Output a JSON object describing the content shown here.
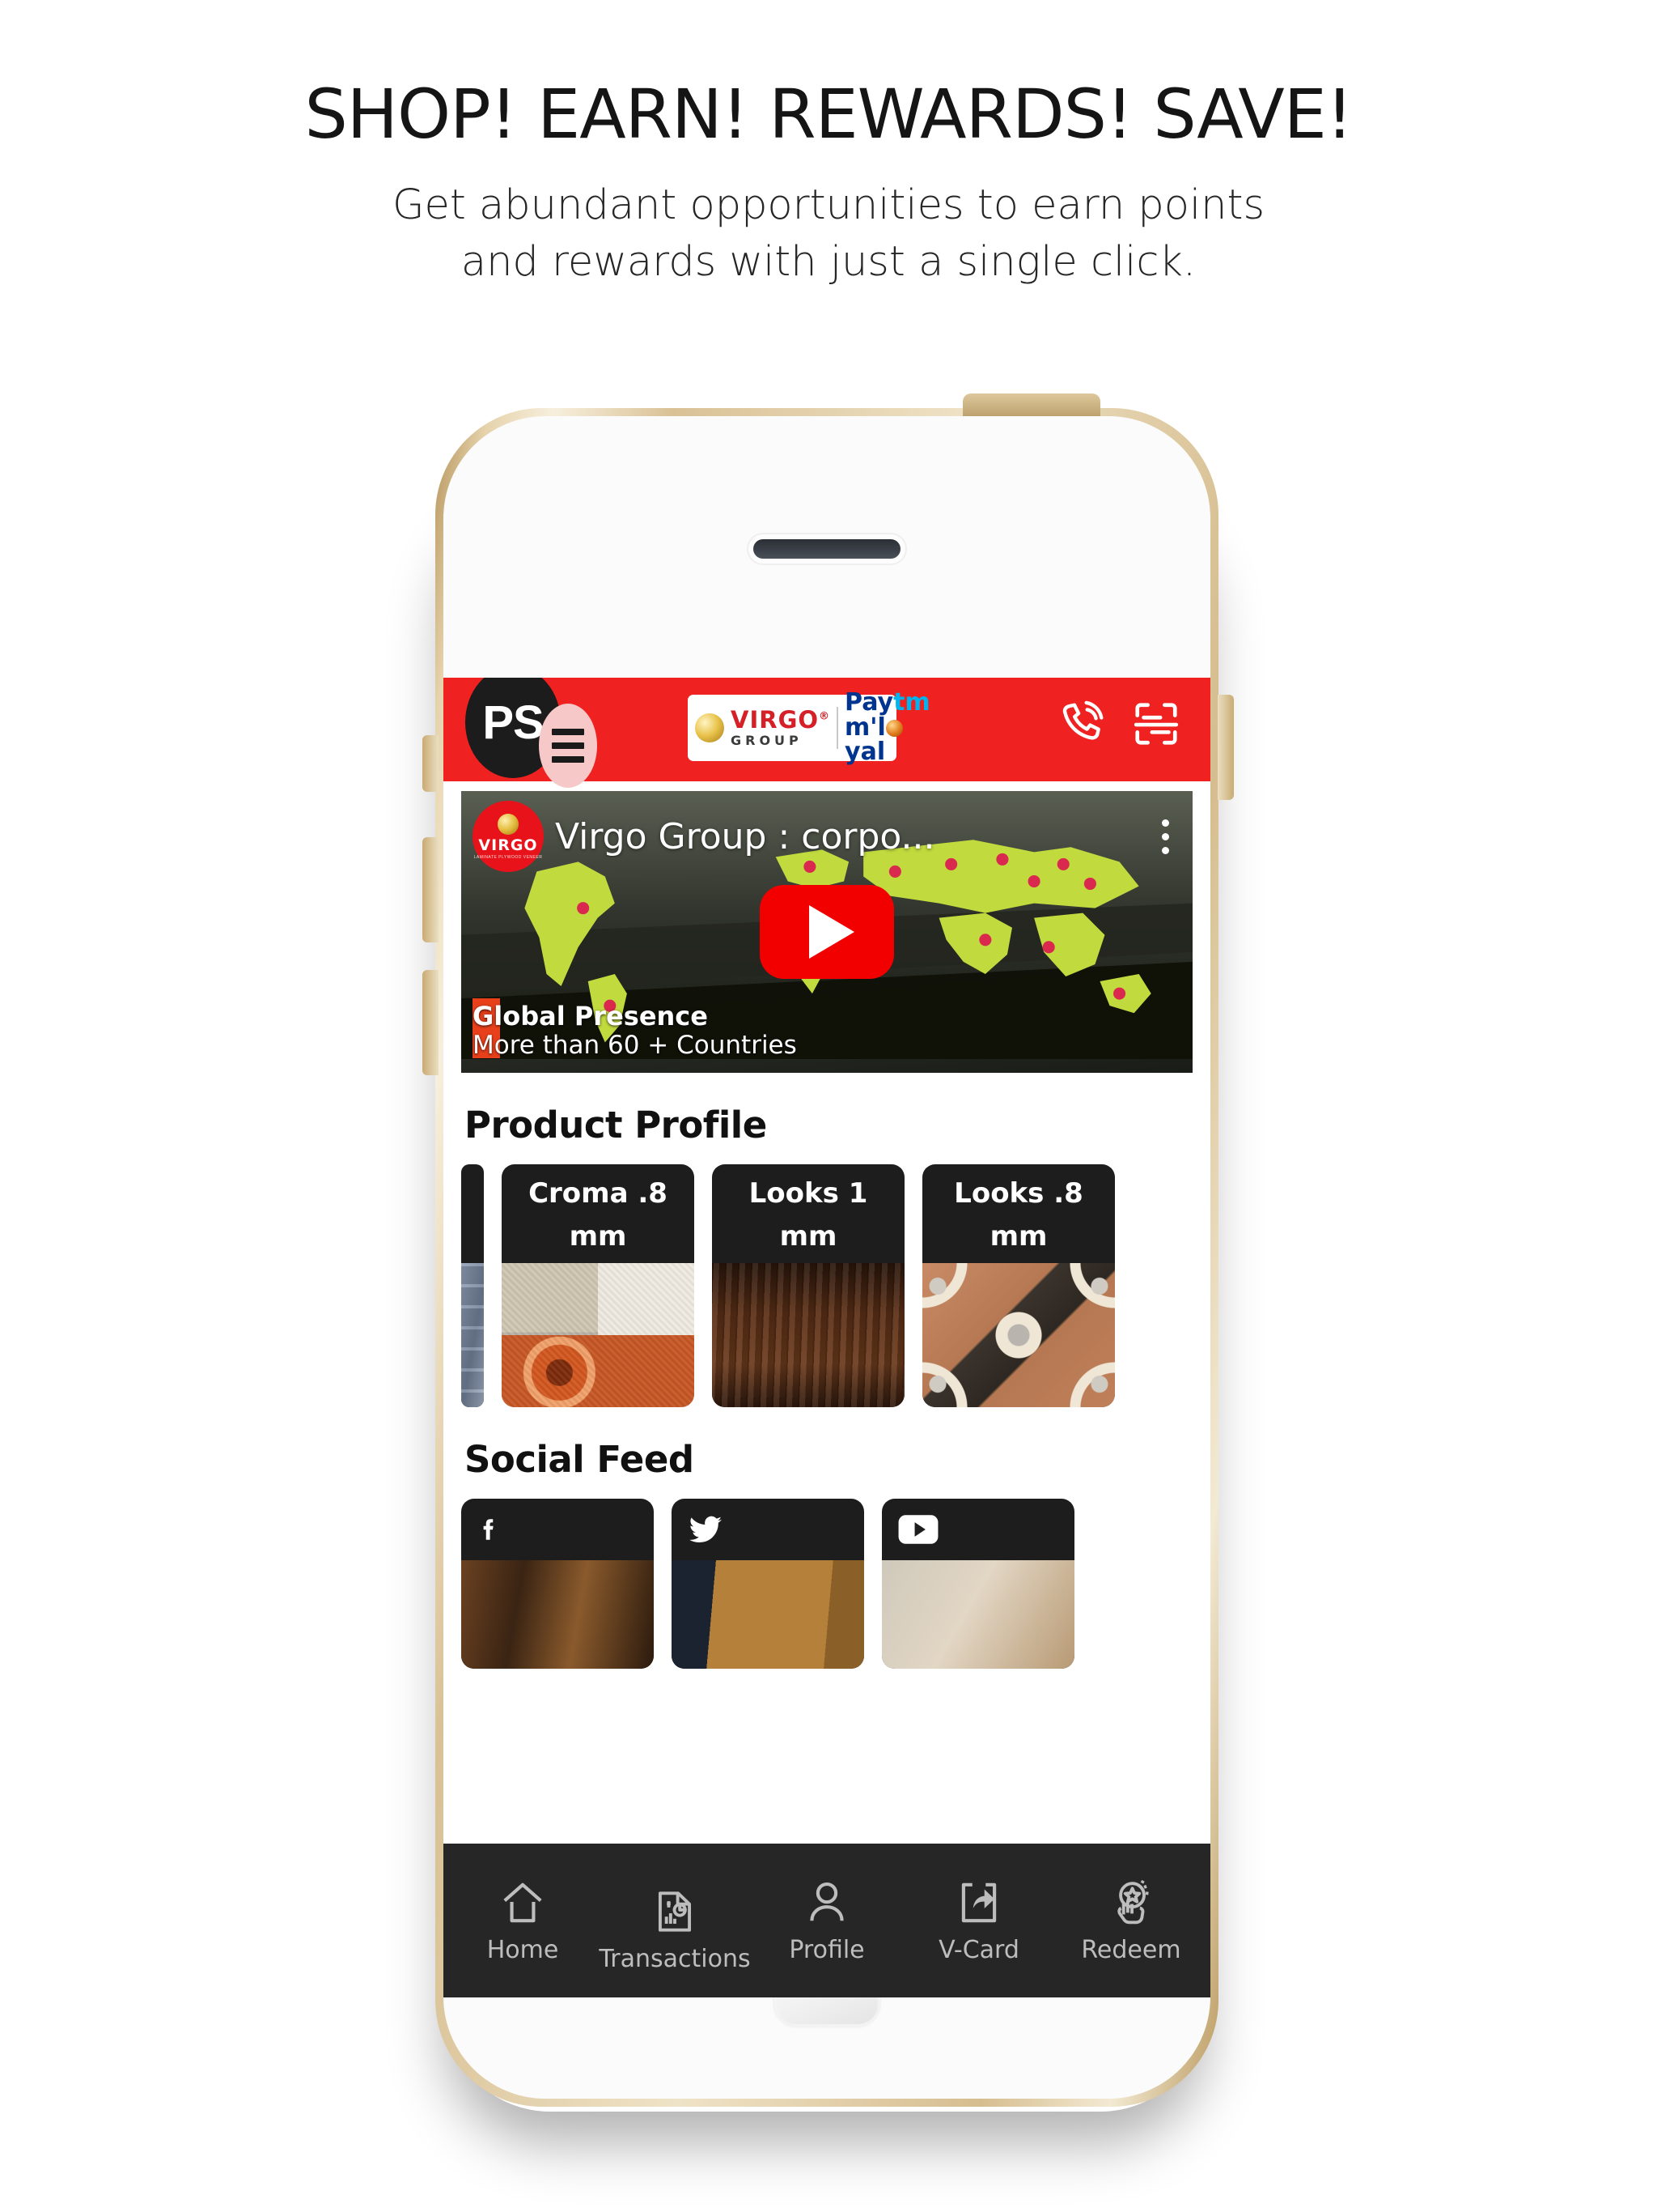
{
  "promo": {
    "title": "SHOP! EARN! REWARDS! SAVE!",
    "subtitle_line1": "Get abundant opportunities to earn points",
    "subtitle_line2": "and rewards with just a single click."
  },
  "colors": {
    "brand_red": "#EF2121",
    "header_text": "#FFFFFF",
    "card_dark": "#1D1D1D",
    "tabbar": "#262626",
    "tab_label": "#BDBDBD",
    "youtube_red": "#F20000",
    "paytm_blue": "#00358F",
    "paytm_cyan": "#00B5EF",
    "virgo_red": "#D42026"
  },
  "app": {
    "header": {
      "avatar_initials": "PS",
      "menu_icon": "hamburger-menu-icon",
      "brand": {
        "virgo_name": "VIRGO",
        "virgo_reg": "®",
        "virgo_group": "GROUP",
        "paytm_line1_a": "Pay",
        "paytm_line1_b": "tm",
        "paytm_line2_a": "m'l",
        "paytm_line2_b": "yal"
      },
      "call_icon": "phone-call-icon",
      "scan_icon": "barcode-scan-icon"
    },
    "video": {
      "channel_name": "VIRGO",
      "channel_tagline": "LAMINATE PLYWOOD VENEER",
      "title": "Virgo Group : corpo...",
      "more_icon": "kebab-menu-icon",
      "play_icon": "play-button-icon",
      "overlay_heading": "Global Presence",
      "overlay_sub": "More than 60 + Countries"
    },
    "sections": [
      {
        "id": "product-profile",
        "title": "Product Profile"
      },
      {
        "id": "social-feed",
        "title": "Social Feed"
      }
    ],
    "product_profile": {
      "title": "Product Profile",
      "cards": [
        {
          "label": "",
          "swatch": "sw-blue",
          "partial": true
        },
        {
          "label": "Croma .8 mm",
          "swatch": "sw-croma",
          "partial": false
        },
        {
          "label": "Looks 1 mm",
          "swatch": "sw-wood",
          "partial": false
        },
        {
          "label": "Looks .8 mm",
          "swatch": "sw-looks8",
          "partial": false
        }
      ]
    },
    "social_feed": {
      "title": "Social Feed",
      "cards": [
        {
          "network": "facebook",
          "icon": "facebook-icon",
          "swatch": "sw-social1"
        },
        {
          "network": "twitter",
          "icon": "twitter-icon",
          "swatch": "sw-social2"
        },
        {
          "network": "youtube",
          "icon": "youtube-icon",
          "swatch": "sw-social3"
        }
      ]
    },
    "tabbar": {
      "items": [
        {
          "label": "Home",
          "icon": "home-icon",
          "active": true
        },
        {
          "label": "Transactions",
          "icon": "transactions-report-icon",
          "active": false
        },
        {
          "label": "Profile",
          "icon": "person-icon",
          "active": false
        },
        {
          "label": "V-Card",
          "icon": "share-card-icon",
          "active": false
        },
        {
          "label": "Redeem",
          "icon": "redeem-hand-star-icon",
          "active": false
        }
      ]
    }
  },
  "device": {
    "speaker": "earpiece-speaker",
    "home_button": "home-button"
  }
}
